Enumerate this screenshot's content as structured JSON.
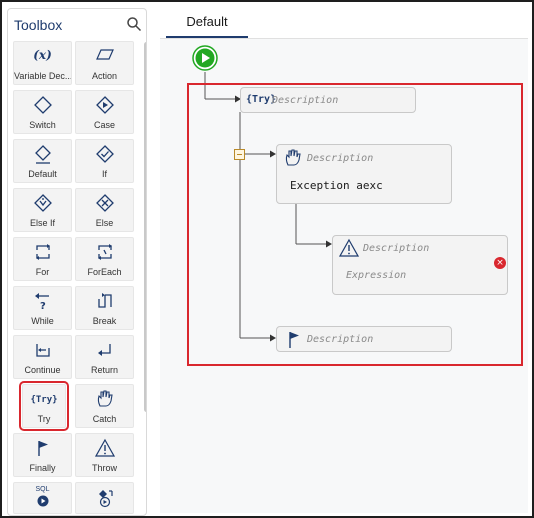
{
  "toolbox": {
    "title": "Toolbox",
    "items": [
      {
        "label": "Variable Dec...",
        "icon": "variable-icon"
      },
      {
        "label": "Action",
        "icon": "action-icon"
      },
      {
        "label": "Switch",
        "icon": "switch-icon"
      },
      {
        "label": "Case",
        "icon": "case-icon"
      },
      {
        "label": "Default",
        "icon": "default-icon"
      },
      {
        "label": "If",
        "icon": "if-icon"
      },
      {
        "label": "Else If",
        "icon": "else-if-icon"
      },
      {
        "label": "Else",
        "icon": "else-icon"
      },
      {
        "label": "For",
        "icon": "for-icon"
      },
      {
        "label": "ForEach",
        "icon": "foreach-icon"
      },
      {
        "label": "While",
        "icon": "while-icon"
      },
      {
        "label": "Break",
        "icon": "break-icon"
      },
      {
        "label": "Continue",
        "icon": "continue-icon"
      },
      {
        "label": "Return",
        "icon": "return-icon"
      },
      {
        "label": "Try",
        "icon": "try-icon"
      },
      {
        "label": "Catch",
        "icon": "catch-icon"
      },
      {
        "label": "Finally",
        "icon": "finally-icon"
      },
      {
        "label": "Throw",
        "icon": "throw-icon"
      },
      {
        "label": "",
        "icon": "sql-icon"
      },
      {
        "label": "",
        "icon": "invoke-icon"
      }
    ],
    "var_glyph": "(x)",
    "sql_glyph": "SQL",
    "try_glyph": "{Try}"
  },
  "tabs": [
    {
      "label": "Default"
    }
  ],
  "flow": {
    "try_badge": "{Try}",
    "try_description": "Description",
    "catch_description": "Description",
    "catch_code": "Exception aexc",
    "throw_description": "Description",
    "throw_expression": "Expression",
    "finally_description": "Description",
    "error_badge": "×"
  },
  "colors": {
    "accent": "#1f3c6e",
    "highlight": "#d9272e",
    "start": "#22a822"
  }
}
